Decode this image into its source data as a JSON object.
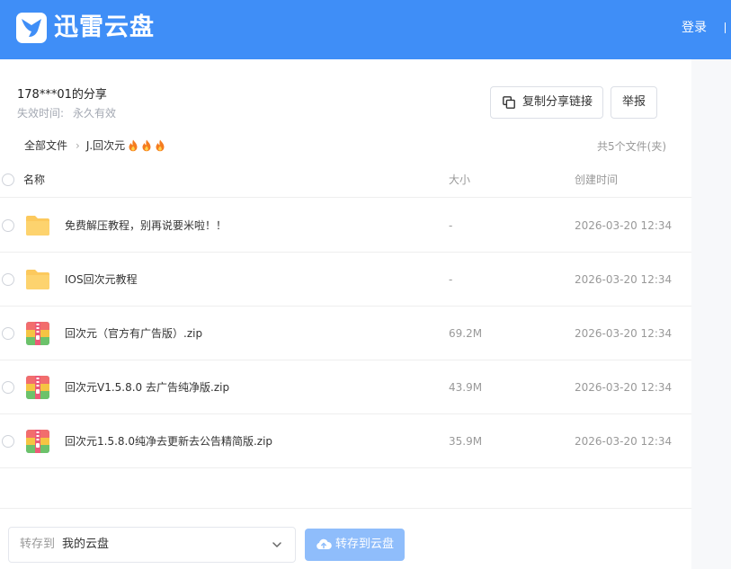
{
  "header": {
    "brand": "迅雷云盘",
    "login": "登录",
    "brand_color": "#3f8ef7"
  },
  "share": {
    "title": "178***01的分享",
    "expiry_label": "失效时间:",
    "expiry_value": "永久有效",
    "copy_link_label": "复制分享链接",
    "report_label": "举报"
  },
  "breadcrumb": {
    "root": "全部文件",
    "current": "J.回次元"
  },
  "file_count": "共5个文件(夹)",
  "table": {
    "columns": {
      "name": "名称",
      "size": "大小",
      "time": "创建时间"
    },
    "rows": [
      {
        "type": "folder",
        "name": "免费解压教程，别再说要米啦！！",
        "size": "-",
        "time": "2026-03-20 12:34"
      },
      {
        "type": "folder",
        "name": "IOS回次元教程",
        "size": "-",
        "time": "2026-03-20 12:34"
      },
      {
        "type": "zip",
        "name": "回次元（官方有广告版）.zip",
        "size": "69.2M",
        "time": "2026-03-20 12:34"
      },
      {
        "type": "zip",
        "name": "回次元V1.5.8.0 去广告纯净版.zip",
        "size": "43.9M",
        "time": "2026-03-20 12:34"
      },
      {
        "type": "zip",
        "name": "回次元1.5.8.0纯净去更新去公告精简版.zip",
        "size": "35.9M",
        "time": "2026-03-20 12:34"
      }
    ]
  },
  "footer": {
    "save_to_label": "转存到",
    "save_to_value": "我的云盘",
    "save_button": "转存到云盘"
  }
}
